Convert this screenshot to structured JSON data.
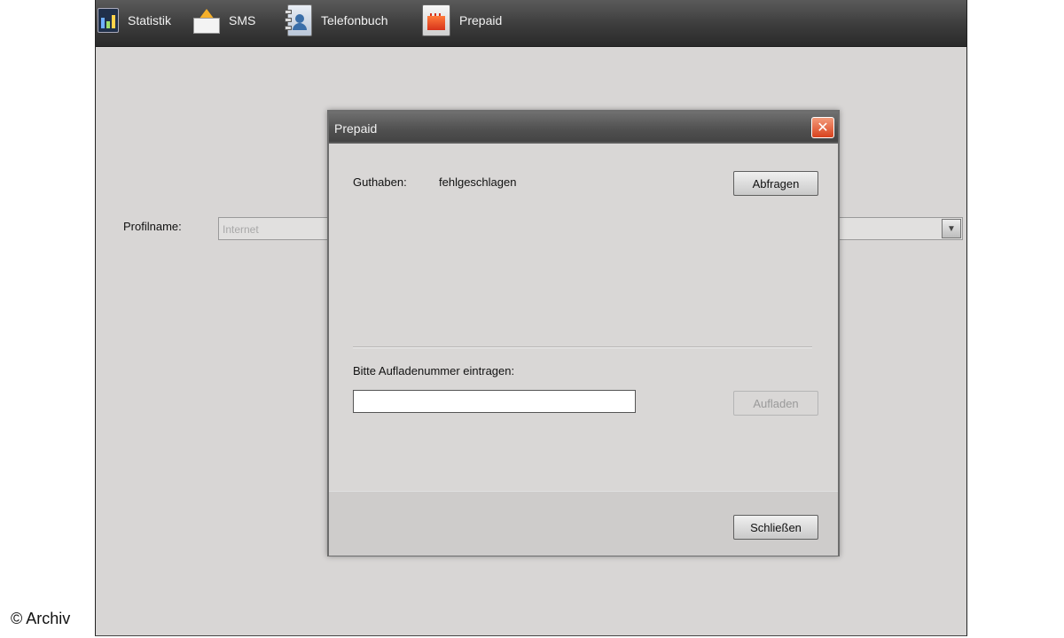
{
  "toolbar": {
    "items": [
      {
        "label": "Statistik",
        "icon": "chart-icon"
      },
      {
        "label": "SMS",
        "icon": "envelope-icon"
      },
      {
        "label": "Telefonbuch",
        "icon": "phonebook-icon"
      },
      {
        "label": "Prepaid",
        "icon": "prepaid-card-icon"
      }
    ]
  },
  "main": {
    "profile_label": "Profilname:",
    "profile_value": "Internet"
  },
  "dialog": {
    "title": "Prepaid",
    "balance_label": "Guthaben:",
    "balance_value": "fehlgeschlagen",
    "query_button": "Abfragen",
    "recharge_label": "Bitte Aufladenummer eintragen:",
    "recharge_input_value": "",
    "recharge_button": "Aufladen",
    "close_button": "Schließen",
    "close_glyph": "✕"
  },
  "watermark": "© Archiv",
  "colors": {
    "toolbar_bg": "#3c3c3c",
    "dialog_bg": "#d9d7d6",
    "close_button": "#d8421d",
    "window_bg": "#d8d6d5"
  }
}
